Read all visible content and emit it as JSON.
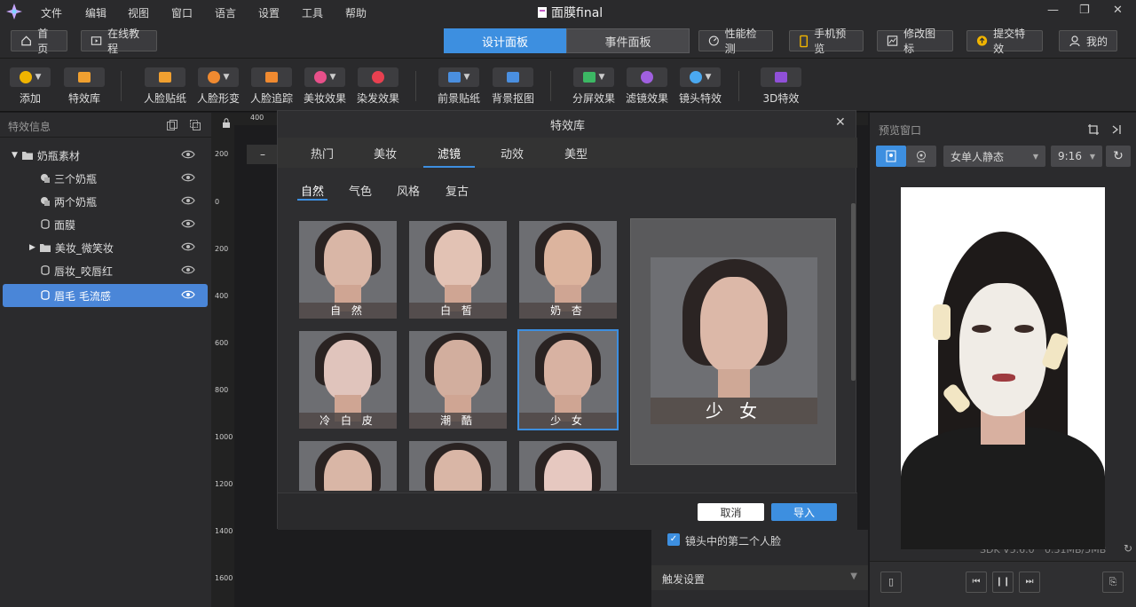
{
  "app": {
    "title": "面膜final"
  },
  "menu": [
    "文件",
    "编辑",
    "视图",
    "窗口",
    "语言",
    "设置",
    "工具",
    "帮助"
  ],
  "nav": {
    "home": "首页",
    "tutorial": "在线教程",
    "tabs": [
      "设计面板",
      "事件面板"
    ],
    "perf": "性能检测",
    "phone_preview": "手机预览",
    "edit_icon": "修改图标",
    "submit": "提交特效",
    "mine": "我的"
  },
  "toolbar": [
    "添加",
    "特效库",
    "人脸贴纸",
    "人脸形变",
    "人脸追踪",
    "美妆效果",
    "染发效果",
    "前景贴纸",
    "背景抠图",
    "分屏效果",
    "滤镜效果",
    "镜头特效",
    "3D特效"
  ],
  "left_panel": {
    "title": "特效信息",
    "tree": [
      {
        "label": "奶瓶素材",
        "indent": 0
      },
      {
        "label": "三个奶瓶",
        "indent": 1
      },
      {
        "label": "两个奶瓶",
        "indent": 1
      },
      {
        "label": "面膜",
        "indent": 1
      },
      {
        "label": "美妆_微笑妆",
        "indent": 1
      },
      {
        "label": "唇妆_咬唇红",
        "indent": 1
      },
      {
        "label": "眉毛 毛流感",
        "indent": 1
      }
    ]
  },
  "ruler": [
    "200",
    "0",
    "200",
    "400",
    "600",
    "800",
    "1000",
    "1200",
    "1400",
    "1600"
  ],
  "top_ruler": "400",
  "modal": {
    "title": "特效库",
    "tabs": [
      "热门",
      "美妆",
      "滤镜",
      "动效",
      "美型"
    ],
    "active_tab": "滤镜",
    "subtabs": [
      "自然",
      "气色",
      "风格",
      "复古"
    ],
    "active_subtab": "自然",
    "items": [
      "自 然",
      "白 皙",
      "奶 杏",
      "冷 白 皮",
      "潮 酷",
      "少 女"
    ],
    "selected": "少 女",
    "preview_label": "少 女",
    "cancel": "取消",
    "import": "导入"
  },
  "lower": {
    "checkbox_label": "镜头中的第二个人脸",
    "trigger": "触发设置"
  },
  "right_panel": {
    "title": "预览窗口",
    "model": "女单人静态",
    "ratio": "9:16",
    "sdk": "SDK V5.6.0",
    "size": "0.31MB/5MB"
  },
  "colors": {
    "accent": "#3d8fe0",
    "selected_row": "#4a86d8"
  }
}
